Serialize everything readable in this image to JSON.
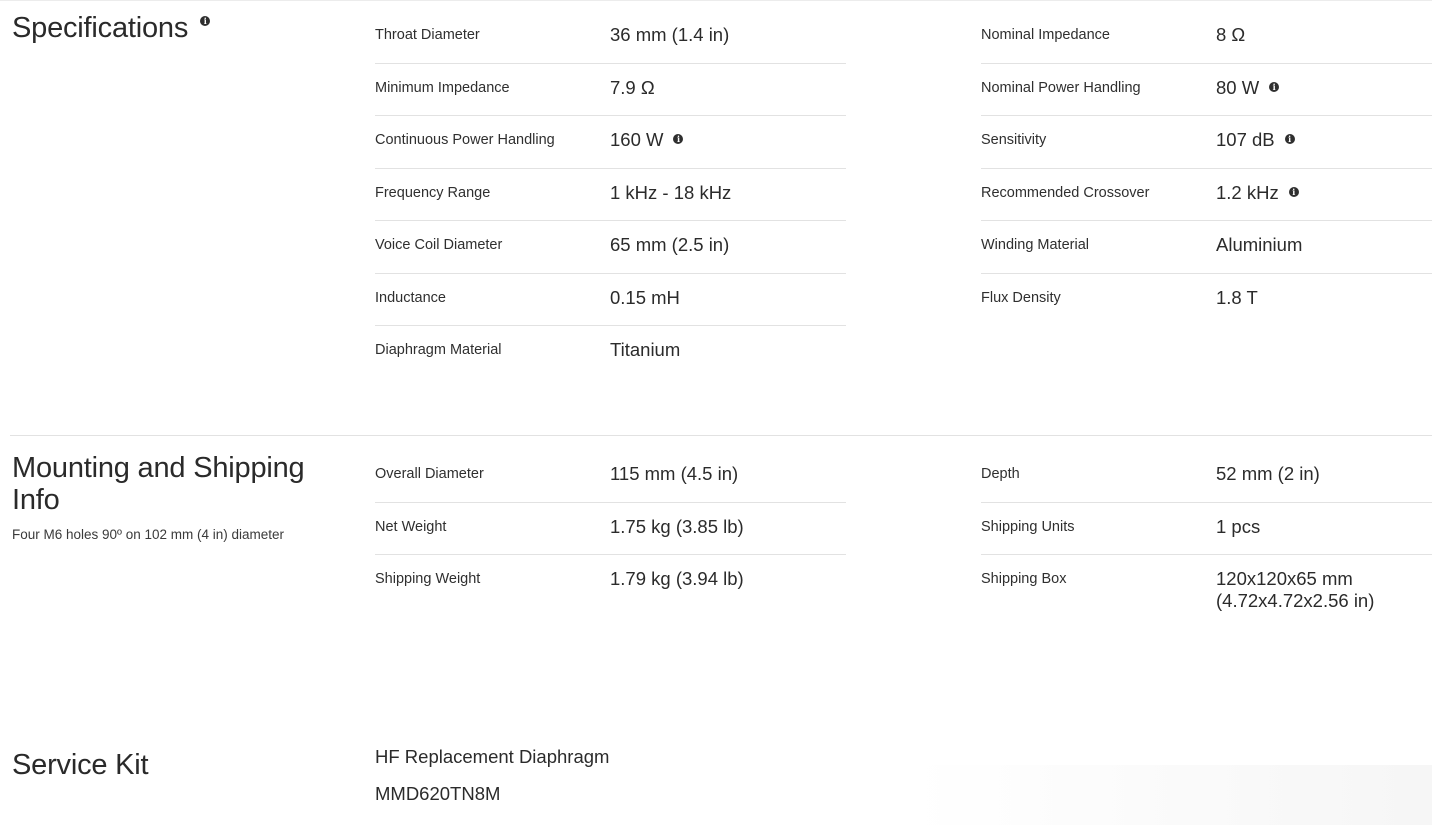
{
  "specifications": {
    "title": "Specifications",
    "left": [
      {
        "label": "Throat Diameter",
        "value": "36 mm (1.4 in)",
        "info": false
      },
      {
        "label": "Minimum Impedance",
        "value": "7.9 Ω",
        "info": false
      },
      {
        "label": "Continuous Power Handling",
        "value": "160 W",
        "info": true
      },
      {
        "label": "Frequency Range",
        "value": "1 kHz - 18 kHz",
        "info": false
      },
      {
        "label": "Voice Coil Diameter",
        "value": "65 mm (2.5 in)",
        "info": false
      },
      {
        "label": "Inductance",
        "value": "0.15 mH",
        "info": false
      },
      {
        "label": "Diaphragm Material",
        "value": "Titanium",
        "info": false
      }
    ],
    "right": [
      {
        "label": "Nominal Impedance",
        "value": "8 Ω",
        "info": false
      },
      {
        "label": "Nominal Power Handling",
        "value": "80 W",
        "info": true
      },
      {
        "label": "Sensitivity",
        "value": "107 dB",
        "info": true
      },
      {
        "label": "Recommended Crossover",
        "value": "1.2 kHz",
        "info": true
      },
      {
        "label": "Winding Material",
        "value": "Aluminium",
        "info": false
      },
      {
        "label": "Flux Density",
        "value": "1.8 T",
        "info": false
      }
    ]
  },
  "mounting": {
    "title_line1": "Mounting and Shipping",
    "title_line2": "Info",
    "subtitle": "Four M6 holes 90º on 102 mm (4 in) diameter",
    "left": [
      {
        "label": "Overall Diameter",
        "value": "115 mm (4.5 in)"
      },
      {
        "label": "Net Weight",
        "value": "1.75 kg (3.85 lb)"
      },
      {
        "label": "Shipping Weight",
        "value": "1.79 kg (3.94 lb)"
      }
    ],
    "right": [
      {
        "label": "Depth",
        "value": "52 mm (2 in)",
        "value2": ""
      },
      {
        "label": "Shipping Units",
        "value": "1 pcs",
        "value2": ""
      },
      {
        "label": "Shipping Box",
        "value": "120x120x65 mm",
        "value2": "(4.72x4.72x2.56 in)"
      }
    ]
  },
  "service_kit": {
    "title": "Service Kit",
    "item_name": "HF Replacement Diaphragm",
    "item_code": "MMD620TN8M"
  },
  "icons": {
    "info": "info-icon"
  }
}
